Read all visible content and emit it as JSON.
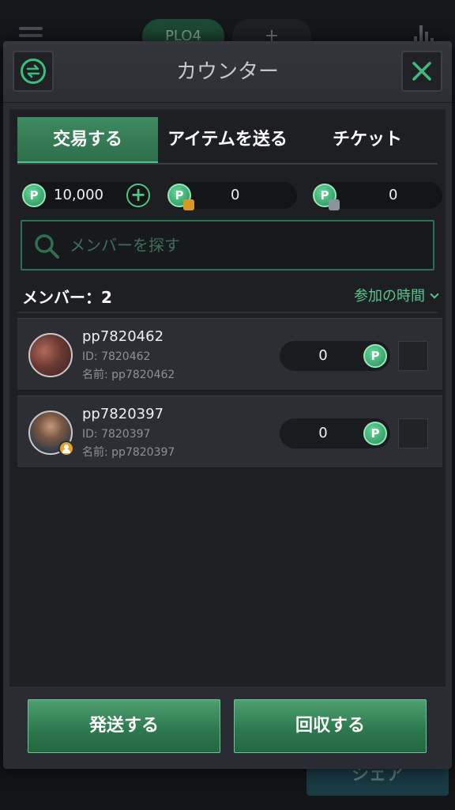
{
  "background": {
    "tab_active": "PLO4",
    "tab_add": "+",
    "share_label": "シェア"
  },
  "modal": {
    "title": "カウンター",
    "tabs": [
      {
        "label": "交易する",
        "active": true
      },
      {
        "label": "アイテムを送る",
        "active": false
      },
      {
        "label": "チケット",
        "active": false
      }
    ],
    "balances": {
      "own": "10,000",
      "agent": "0",
      "club": "0",
      "coin_letter": "P"
    },
    "search": {
      "placeholder": "メンバーを探す"
    },
    "members_label": "メンバー：2",
    "sort_label": "参加の時間",
    "members": [
      {
        "username": "pp7820462",
        "id_line": "ID: 7820462",
        "name_line": "名前: pp7820462",
        "amount": "0",
        "host": false
      },
      {
        "username": "pp7820397",
        "id_line": "ID: 7820397",
        "name_line": "名前: pp7820397",
        "amount": "0",
        "host": true
      }
    ],
    "buttons": {
      "send": "発送する",
      "collect": "回収する"
    }
  },
  "colors": {
    "accent": "#3dbd7d",
    "panel": "#1d1f23",
    "modal": "#2a2c33"
  }
}
